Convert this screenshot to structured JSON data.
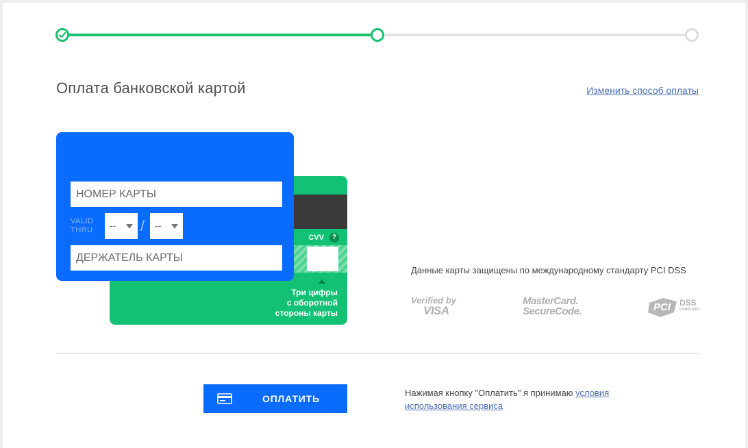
{
  "stepper": {
    "steps": [
      {
        "state": "completed"
      },
      {
        "state": "current"
      },
      {
        "state": "pending"
      }
    ],
    "colors": {
      "active": "#15c26b",
      "inactive": "#dcdcdc"
    }
  },
  "page_title": "Оплата банковской картой",
  "change_method_link": "Изменить способ оплаты",
  "card_front": {
    "card_number_placeholder": "НОМЕР КАРТЫ",
    "valid_thru_line1": "VALID",
    "valid_thru_line2": "THRU",
    "month_value": "--",
    "year_value": "--",
    "separator": "/",
    "holder_placeholder": "ДЕРЖАТЕЛЬ КАРТЫ",
    "color": "#0a6cff"
  },
  "card_back": {
    "cvv_label": "CVV",
    "cvv_help": "?",
    "hint_line1": "Три цифры",
    "hint_line2": "с оборотной",
    "hint_line3": "стороны карты",
    "color": "#12c173"
  },
  "security": {
    "text": "Данные карты защищены по международному стандарту PCI DSS",
    "badges": {
      "visa_line1": "Verified by",
      "visa_line2": "VISA",
      "mc_line1": "MasterCard.",
      "mc_line2": "SecureCode.",
      "pci_main": "PCI",
      "pci_dss": "DSS",
      "pci_compliant": "COMPLIANT"
    }
  },
  "pay_button": {
    "label": "ОПЛАТИТЬ",
    "icon": "credit-card-icon"
  },
  "terms": {
    "text": "Нажимая кнопку \"Оплатить\" я принимаю ",
    "link_part1": "условия",
    "link_part2": "использования сервиса"
  }
}
